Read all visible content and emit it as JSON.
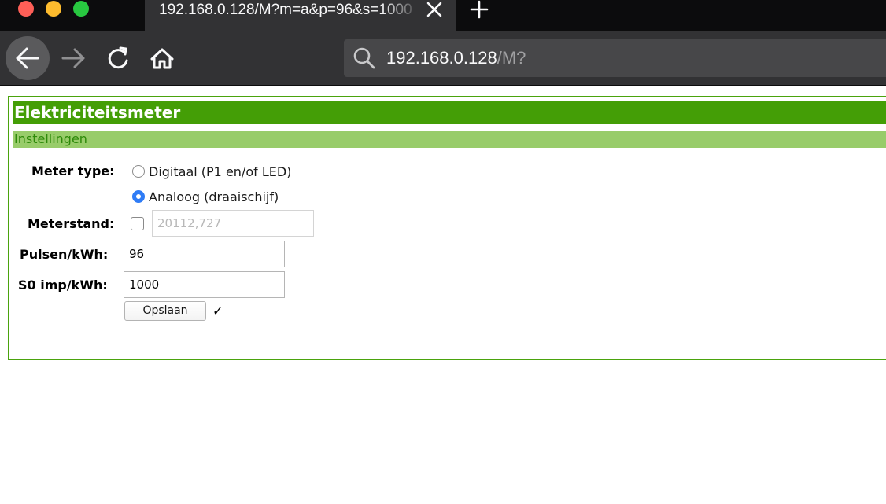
{
  "browser": {
    "tab_title": "192.168.0.128/M?m=a&p=96&s=1000",
    "url_host": "192.168.0.128",
    "url_path": "/M?"
  },
  "page": {
    "title": "Elektriciteitsmeter",
    "subtitle": "Instellingen",
    "meter_type": {
      "label": "Meter type:",
      "options": [
        {
          "label": "Digitaal (P1 en/of LED)",
          "selected": false
        },
        {
          "label": "Analoog (draaischijf)",
          "selected": true
        }
      ]
    },
    "meterstand": {
      "label": "Meterstand:",
      "checked": false,
      "placeholder": "20112,727"
    },
    "pulsen": {
      "label": "Pulsen/kWh:",
      "value": "96"
    },
    "s0": {
      "label": "S0 imp/kWh:",
      "value": "1000"
    },
    "save_label": "Opslaan",
    "status_mark": "✓"
  },
  "colors": {
    "title_bar": "#449e06",
    "subtitle_bar": "#98cc6a",
    "panel_border": "#4aa30d",
    "radio_selected": "#2f7cf6"
  },
  "icons": {
    "back": "arrow-left-icon",
    "forward": "arrow-right-icon",
    "reload": "reload-icon",
    "home": "home-icon",
    "search": "search-icon",
    "close_tab": "close-icon",
    "new_tab": "plus-icon"
  }
}
